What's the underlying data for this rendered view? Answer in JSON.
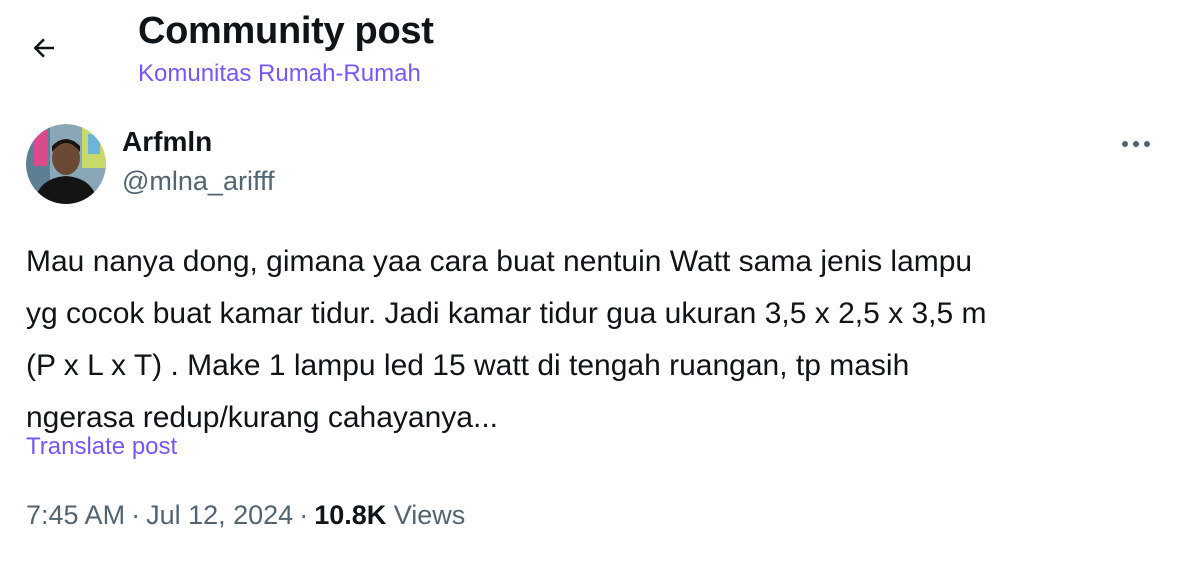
{
  "header": {
    "title": "Community post",
    "community": "Komunitas Rumah-Rumah",
    "back_icon": "arrow-left-icon"
  },
  "post": {
    "author": {
      "name": "Arfmln",
      "handle": "@mlna_arifff",
      "avatar_icon": "user-avatar"
    },
    "more_icon": "more-horizontal-icon",
    "text": "Mau nanya dong, gimana yaa cara buat nentuin Watt sama jenis lampu\nyg cocok buat kamar tidur. Jadi kamar tidur gua ukuran 3,5 x 2,5 x 3,5 m\n(P x L x T) . Make 1 lampu led 15 watt di tengah ruangan, tp masih\nngerasa redup/kurang cahayanya...",
    "translate_label": "Translate post",
    "time": "7:45 AM",
    "date": "Jul 12, 2024",
    "separator": "·",
    "views_count": "10.8K",
    "views_label": "Views"
  },
  "colors": {
    "accent": "#7856ff",
    "text_primary": "#0f1419",
    "text_secondary": "#536471"
  }
}
